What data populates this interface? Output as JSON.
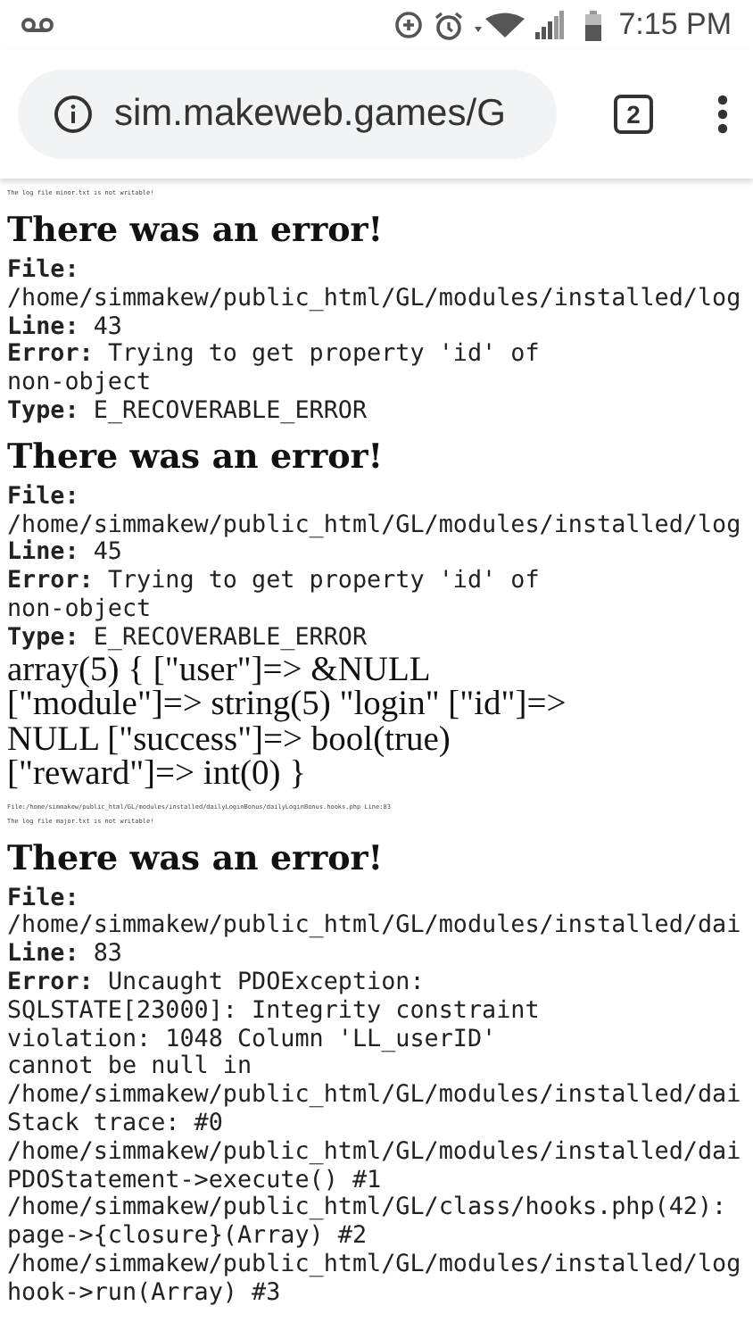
{
  "status_bar": {
    "time": "7:15 PM"
  },
  "browser": {
    "url": "sim.makeweb.games/G",
    "tab_count": "2"
  },
  "content": [
    {
      "kind": "note",
      "text": "The log file minor.txt is not writable!"
    },
    {
      "kind": "error",
      "title": "There was an error!",
      "file_label": "File:",
      "file": "/home/simmakew/public_html/GL/modules/installed/log",
      "line_label": "Line:",
      "line": "43",
      "error_label": "Error:",
      "message": [
        "Trying to get property 'id' of",
        "non-object"
      ],
      "type_label": "Type:",
      "type": "E_RECOVERABLE_ERROR"
    },
    {
      "kind": "error",
      "title": "There was an error!",
      "file_label": "File:",
      "file": "/home/simmakew/public_html/GL/modules/installed/log",
      "line_label": "Line:",
      "line": "45",
      "error_label": "Error:",
      "message": [
        "Trying to get property 'id' of",
        "non-object"
      ],
      "type_label": "Type:",
      "type": "E_RECOVERABLE_ERROR"
    },
    {
      "kind": "dump",
      "text": "array(5) { [\"user\"]=> &NULL [\"module\"]=> string(5) \"login\" [\"id\"]=> NULL [\"success\"]=> bool(true) [\"reward\"]=> int(0) }"
    },
    {
      "kind": "note",
      "text": "File:/home/simmakew/public_html/GL/modules/installed/dailyLoginBonus/dailyLoginBonus.hooks.php Line:83"
    },
    {
      "kind": "note",
      "text": "The log file major.txt is not writable!"
    },
    {
      "kind": "error",
      "title": "There was an error!",
      "file_label": "File:",
      "file": "/home/simmakew/public_html/GL/modules/installed/dai",
      "line_label": "Line:",
      "line": "83",
      "error_label": "Error:",
      "message": [
        "Uncaught PDOException:",
        "SQLSTATE[23000]: Integrity constraint",
        "violation: 1048 Column 'LL_userID'",
        "cannot be null in",
        "/home/simmakew/public_html/GL/modules/installed/dai",
        "Stack trace: #0",
        "/home/simmakew/public_html/GL/modules/installed/dai",
        "PDOStatement->execute() #1",
        "/home/simmakew/public_html/GL/class/hooks.php(42):",
        "page->{closure}(Array) #2",
        "/home/simmakew/public_html/GL/modules/installed/log",
        "hook->run(Array) #3"
      ]
    }
  ]
}
